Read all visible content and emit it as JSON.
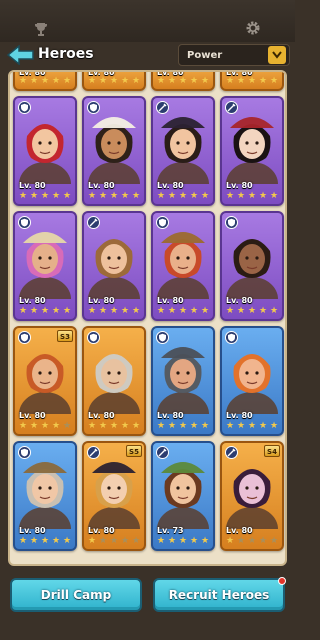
{
  "header": {
    "title": "Heroes",
    "sort_label": "Power"
  },
  "footer": {
    "drill_label": "Drill Camp",
    "recruit_label": "Recruit Heroes"
  },
  "colors": {
    "card_purple": "#8e5fd0",
    "card_orange": "#e6952d",
    "card_blue": "#4b8fd8",
    "star_filled": "#f2c94c",
    "star_empty": "#a98f5b",
    "button_cyan": "#3fbfd6"
  },
  "partial_row": [
    {
      "level": "Lv. 80",
      "color": "orange"
    },
    {
      "level": "Lv. 80",
      "color": "orange"
    },
    {
      "level": "Lv. 80",
      "color": "orange"
    },
    {
      "level": "Lv. 80",
      "color": "orange"
    }
  ],
  "cards": [
    {
      "level": "Lv. 80",
      "color": "purple",
      "role_icon": "shield-icon",
      "stars": 5,
      "tier": "",
      "hair": "#c3262f",
      "skin": "#f2c6a0",
      "hat": ""
    },
    {
      "level": "Lv. 80",
      "color": "purple",
      "role_icon": "shield-icon",
      "stars": 5,
      "tier": "",
      "hair": "#2e2119",
      "skin": "#c98c5c",
      "hat": "#f4efe4"
    },
    {
      "level": "Lv. 80",
      "color": "purple",
      "role_icon": "sword-icon",
      "stars": 5,
      "tier": "",
      "hair": "#2a1d18",
      "skin": "#f1c4a0",
      "hat": "#2b2233"
    },
    {
      "level": "Lv. 80",
      "color": "purple",
      "role_icon": "sword-icon",
      "stars": 5,
      "tier": "",
      "hair": "#1a1213",
      "skin": "#f3d5c0",
      "hat": "#a8252a"
    },
    {
      "level": "Lv. 80",
      "color": "purple",
      "role_icon": "shield-icon",
      "stars": 5,
      "tier": "",
      "hair": "#d86bb8",
      "skin": "#e5b08a",
      "hat": "#e6d7a8"
    },
    {
      "level": "Lv. 80",
      "color": "purple",
      "role_icon": "sword-icon",
      "stars": 5,
      "tier": "",
      "hair": "#9c6a3a",
      "skin": "#eec19c",
      "hat": ""
    },
    {
      "level": "Lv. 80",
      "color": "purple",
      "role_icon": "shield-icon",
      "stars": 5,
      "tier": "",
      "hair": "#c84a2a",
      "skin": "#e9b08a",
      "hat": "#9c6a2e"
    },
    {
      "level": "Lv. 80",
      "color": "purple",
      "role_icon": "shield-icon",
      "stars": 5,
      "tier": "",
      "hair": "#2b1c14",
      "skin": "#9a6446",
      "hat": ""
    },
    {
      "level": "Lv. 80",
      "color": "orange",
      "role_icon": "shield-icon",
      "stars": 4,
      "tier": "S3",
      "hair": "#c85a26",
      "skin": "#eab48a",
      "hat": ""
    },
    {
      "level": "Lv. 80",
      "color": "orange",
      "role_icon": "shield-icon",
      "stars": 5,
      "tier": "",
      "hair": "#cfcac0",
      "skin": "#e8c2a0",
      "hat": ""
    },
    {
      "level": "Lv. 80",
      "color": "blue",
      "role_icon": "shield-icon",
      "stars": 5,
      "tier": "",
      "hair": "#555b63",
      "skin": "#e3a682",
      "hat": "#4b5058"
    },
    {
      "level": "Lv. 80",
      "color": "blue",
      "role_icon": "shield-icon",
      "stars": 5,
      "tier": "",
      "hair": "#e2722b",
      "skin": "#f1b58e",
      "hat": ""
    },
    {
      "level": "Lv. 80",
      "color": "blue",
      "role_icon": "shield-icon",
      "stars": 5,
      "tier": "",
      "hair": "#c9c0b2",
      "skin": "#f0c7a6",
      "hat": "#8a6a3c"
    },
    {
      "level": "Lv. 80",
      "color": "orange",
      "role_icon": "sword-icon",
      "stars": 1,
      "tier": "S5",
      "hair": "#d8a04a",
      "skin": "#f3cfb0",
      "hat": "#2b2230"
    },
    {
      "level": "Lv. 73",
      "color": "blue",
      "role_icon": "sword-icon",
      "stars": 5,
      "tier": "",
      "hair": "#6b3a20",
      "skin": "#f0c49e",
      "hat": "#5c8a3a"
    },
    {
      "level": "Lv. 80",
      "color": "orange",
      "role_icon": "sword-icon",
      "stars": 1,
      "tier": "S4",
      "hair": "#3a1d3a",
      "skin": "#eac0d6",
      "hat": ""
    }
  ]
}
